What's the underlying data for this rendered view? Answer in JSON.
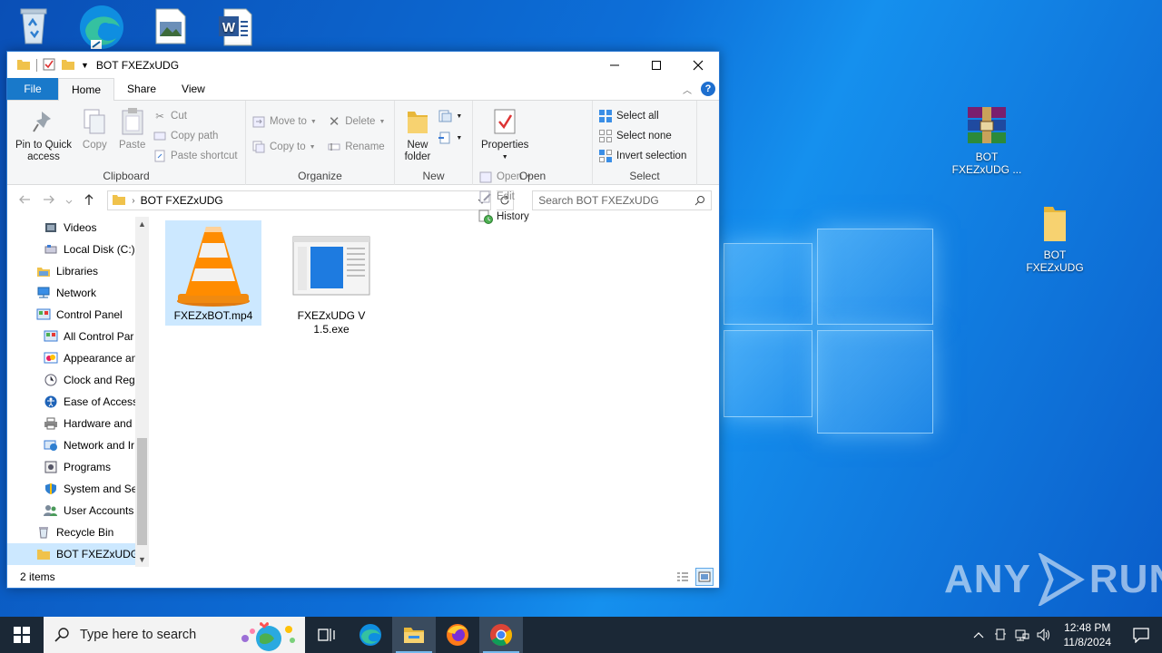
{
  "desktop": {
    "icons": [
      {
        "name": "recycle-bin",
        "label": ""
      },
      {
        "name": "edge",
        "label": ""
      },
      {
        "name": "picture-doc",
        "label": ""
      },
      {
        "name": "word-doc",
        "label": ""
      }
    ],
    "rar_label_1": "BOT",
    "rar_label_2": "FXEZxUDG ...",
    "folder_label_1": "BOT",
    "folder_label_2": "FXEZxUDG",
    "watermark_left": "ANY",
    "watermark_right": "RUN"
  },
  "window": {
    "title": "BOT FXEZxUDG",
    "tabs": {
      "file": "File",
      "home": "Home",
      "share": "Share",
      "view": "View"
    },
    "ribbon": {
      "clipboard": {
        "pin_line1": "Pin to Quick",
        "pin_line2": "access",
        "copy": "Copy",
        "paste": "Paste",
        "cut": "Cut",
        "copy_path": "Copy path",
        "paste_shortcut": "Paste shortcut",
        "group": "Clipboard"
      },
      "organize": {
        "move_to": "Move to",
        "copy_to": "Copy to",
        "delete": "Delete",
        "rename": "Rename",
        "group": "Organize"
      },
      "new": {
        "new_folder_line1": "New",
        "new_folder_line2": "folder",
        "group": "New"
      },
      "open": {
        "properties": "Properties",
        "open": "Open",
        "edit": "Edit",
        "history": "History",
        "group": "Open"
      },
      "select": {
        "select_all": "Select all",
        "select_none": "Select none",
        "invert": "Invert selection",
        "group": "Select"
      }
    },
    "address": {
      "path": "BOT FXEZxUDG",
      "search_placeholder": "Search BOT FXEZxUDG"
    },
    "nav_items": [
      "Videos",
      "Local Disk (C:)",
      "Libraries",
      "Network",
      "Control Panel",
      "All Control Par",
      "Appearance an",
      "Clock and Regi",
      "Ease of Access",
      "Hardware and",
      "Network and Ir",
      "Programs",
      "System and Sec",
      "User Accounts",
      "Recycle Bin",
      "BOT FXEZxUDG"
    ],
    "files": [
      {
        "name": "FXEZxBOT.mp4",
        "type": "vlc"
      },
      {
        "name_line1": "FXEZxUDG V",
        "name_line2": "1.5.exe",
        "type": "exe"
      }
    ],
    "status": "2 items"
  },
  "taskbar": {
    "search_placeholder": "Type here to search",
    "time": "12:48 PM",
    "date": "11/8/2024"
  }
}
